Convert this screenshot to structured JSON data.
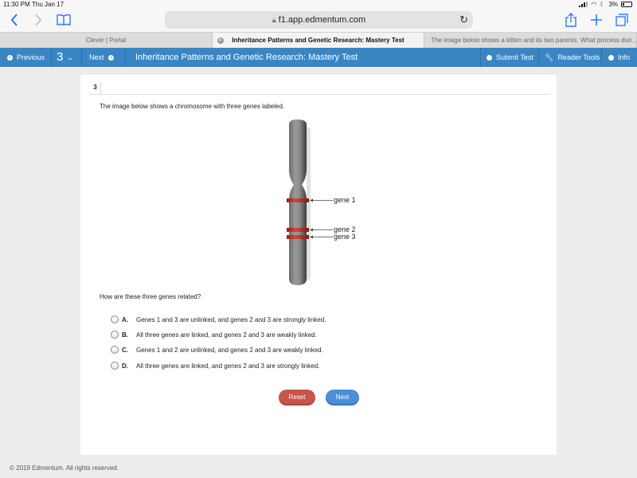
{
  "status": {
    "time": "11:30 PM",
    "date": "Thu Jan 17",
    "battery": "3%"
  },
  "browser": {
    "url": "f1.app.edmentum.com",
    "tabs": [
      {
        "label": "Clever | Portal"
      },
      {
        "label": "Inheritance Patterns and Genetic Research: Mastery Test"
      },
      {
        "label": "The image below shows a kitten and its two parents. What process duri..."
      }
    ]
  },
  "header": {
    "previous": "Previous",
    "question_number": "3",
    "next": "Next",
    "title": "Inheritance Patterns and Genetic Research: Mastery Test",
    "submit": "Submit Test",
    "reader_tools": "Reader Tools",
    "info": "Info"
  },
  "question": {
    "number": "3",
    "prompt": "The image below shows a chromosome with three genes labeled.",
    "figure_labels": [
      "gene 1",
      "gene 2",
      "gene 3"
    ],
    "stem": "How are these three genes related?",
    "choices": [
      {
        "letter": "A.",
        "text": "Genes 1 and 3 are unlinked, and genes 2 and 3 are strongly linked."
      },
      {
        "letter": "B.",
        "text": "All three genes are linked, and genes 2 and 3 are weakly linked."
      },
      {
        "letter": "C.",
        "text": "Genes 1 and 2 are unlinked, and genes 2 and 3 are weakly linked."
      },
      {
        "letter": "D.",
        "text": "All three genes are linked, and genes 2 and 3 are strongly linked."
      }
    ],
    "reset_label": "Reset",
    "next_label": "Next"
  },
  "footer": "© 2019 Edmentum. All rights reserved.",
  "colors": {
    "accent": "#3a86c4",
    "reset": "#c8554a",
    "next": "#4a90d6",
    "gene_band": "#c0392b"
  },
  "icons": [
    "back-icon",
    "forward-icon",
    "bookmarks-icon",
    "lock-icon",
    "reload-icon",
    "share-icon",
    "new-tab-icon",
    "tabs-icon"
  ]
}
